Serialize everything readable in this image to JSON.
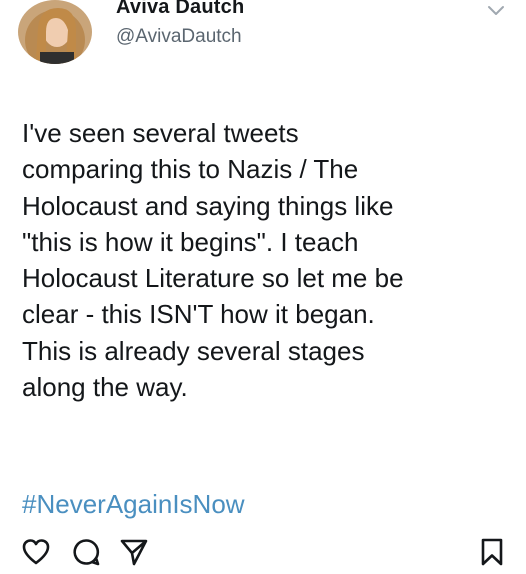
{
  "user": {
    "display_name": "Aviva Dautch",
    "handle": "@AvivaDautch"
  },
  "tweet": {
    "lines": [
      "I've seen several tweets",
      "comparing this to Nazis / The",
      "Holocaust and saying things like",
      "\"this is how it begins\". I teach",
      "Holocaust Literature so let me be",
      "clear - this ISN'T how it began.",
      "This is already several stages",
      "along the way."
    ],
    "hashtag": "#NeverAgainIsNow"
  },
  "colors": {
    "text": "#14171a",
    "handle": "#5b6670",
    "hashtag": "#4a8fc0",
    "background": "#ffffff"
  },
  "icons": {
    "menu": "chevron-down-icon",
    "like": "heart-icon",
    "comment": "comment-icon",
    "share": "send-icon",
    "save": "bookmark-icon"
  }
}
